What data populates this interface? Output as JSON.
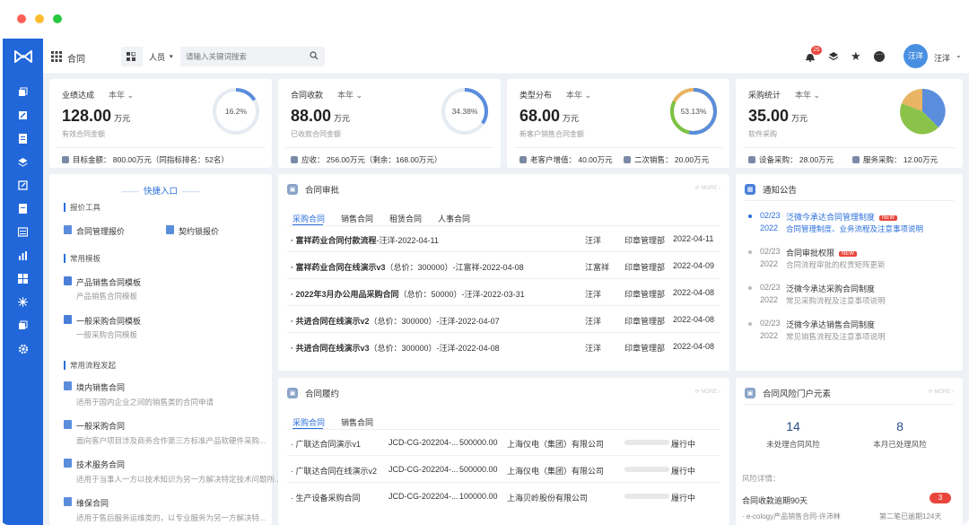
{
  "window_title": "合同",
  "topbar": {
    "app_label": "合同",
    "search_scope": "人员",
    "search_placeholder": "请输入关键词搜索",
    "notification_count": "25",
    "user_avatar_text": "汪洋",
    "user_name": "汪洋"
  },
  "kpis": [
    {
      "title": "业绩达成",
      "year": "本年",
      "value": "128.00",
      "unit": "万元",
      "sub": "有效合同金额",
      "ring_label": "16.2%",
      "ring_fraction": 0.162,
      "foot": "目标金额：  800.00万元（同指标排名：52名）"
    },
    {
      "title": "合同收款",
      "year": "本年",
      "value": "88.00",
      "unit": "万元",
      "sub": "已收款合同金额",
      "ring_label": "34.38%",
      "ring_fraction": 0.3438,
      "foot": "应收：  256.00万元（剩余：168.00万元）"
    },
    {
      "title": "类型分布",
      "year": "本年",
      "value": "68.00",
      "unit": "万元",
      "sub": "新客户销售合同金额",
      "ring_label": "53.13%",
      "ring_fraction": 0.5313,
      "foot_a": "老客户增值：  40.00万元",
      "foot_b": "二次销售：  20.00万元"
    },
    {
      "title": "采购统计",
      "year": "本年",
      "value": "35.00",
      "unit": "万元",
      "sub": "软件采购",
      "foot_a": "设备采购：  28.00万元",
      "foot_b": "服务采购：  12.00万元"
    }
  ],
  "colors": {
    "accent": "#2a6fdb",
    "sidebar": "#2167d9",
    "ring_track": "#e6ebf3",
    "ring_fill": "#4a7fd8",
    "ring_green": "#7cc243",
    "ring_yellow": "#e9b463",
    "pie_blue": "#5b8ddd",
    "pie_green": "#8bc34a",
    "pie_yellow": "#e9b463"
  },
  "quick": {
    "title": "快捷入口",
    "sec1": "报价工具",
    "item1": "合同管理报价",
    "item2": "契约锁报价",
    "sec2": "常用模板",
    "tpl1": "产品销售合同模板",
    "tpl1_sub": "产品销售合同模板",
    "tpl2": "一般采购合同模板",
    "tpl2_sub": "一般采购合同模板",
    "sec3": "常用流程发起",
    "flow1": "境内销售合同",
    "flow1_sub": "适用于国内企业之间的销售类的合同申请",
    "flow2": "一般采购合同",
    "flow2_sub": "面向客户项目涉及商务合作第三方标准产品软硬件采购...",
    "flow3": "技术服务合同",
    "flow3_sub": "适用于当事人一方以技术知识为另一方解决特定技术问题所...",
    "flow4": "维保合同",
    "flow4_sub": "适用于售后服务运维类的，以专业服务为另一方解决特..."
  },
  "approval": {
    "title": "合同审批",
    "more": "MORE",
    "tabs": [
      "采购合同",
      "销售合同",
      "租赁合同",
      "人事合同"
    ],
    "rows": [
      {
        "title": "· 富祥药业合同付款流程",
        "extra": "-汪洋-2022-04-11",
        "user": "汪洋",
        "dept": "印章管理部",
        "date": "2022-04-11"
      },
      {
        "title": "· 富祥药业合同在线演示v3",
        "extra": "（总价：300000）-江富祥-2022-04-08",
        "user": "江富祥",
        "dept": "印章管理部",
        "date": "2022-04-09"
      },
      {
        "title": "· 2022年3月办公用品采购合同",
        "extra": "（总价：50000）-汪洋-2022-03-31",
        "user": "汪洋",
        "dept": "印章管理部",
        "date": "2022-04-08"
      },
      {
        "title": "· 共进合同在线演示v2",
        "extra": "（总价：300000）-汪洋-2022-04-07",
        "user": "汪洋",
        "dept": "印章管理部",
        "date": "2022-04-08"
      },
      {
        "title": "· 共进合同在线演示v3",
        "extra": "（总价：300000）-汪洋-2022-04-08",
        "user": "汪洋",
        "dept": "印章管理部",
        "date": "2022-04-08"
      }
    ]
  },
  "perform": {
    "title": "合同履约",
    "more": "MORE",
    "tabs": [
      "采购合同",
      "销售合同"
    ],
    "rows": [
      {
        "name": "· 广联达合同演示v1",
        "code": "JCD-CG-202204-...",
        "amount": "500000.00",
        "party": "上海仪电（集团）有限公司",
        "progress": 0.0,
        "status": "履行中"
      },
      {
        "name": "· 广联达合同在线演示v2",
        "code": "JCD-CG-202204-...",
        "amount": "500000.00",
        "party": "上海仪电（集团）有限公司",
        "progress": 0.0,
        "status": "履行中"
      },
      {
        "name": "· 生产设备采购合同",
        "code": "JCD-CG-202204-...",
        "amount": "100000.00",
        "party": "上海贝岭股份有限公司",
        "progress": 0.0,
        "status": "履行中"
      }
    ]
  },
  "notice": {
    "title": "通知公告",
    "new_tag": "NEW",
    "items": [
      {
        "md": "02/23",
        "year": "2022",
        "title": "泛微今承达合同管理制度",
        "sub": "合同管理制度、业务流程及注意事项说明",
        "is_new": true,
        "active": true
      },
      {
        "md": "02/23",
        "year": "2022",
        "title": "合同审批权限",
        "sub": "合同流程审批的权责矩阵更新",
        "is_new": true,
        "active": false
      },
      {
        "md": "02/23",
        "year": "2022",
        "title": "泛微今承达采购合同制度",
        "sub": "常见采购流程及注意事项说明",
        "is_new": false,
        "active": false
      },
      {
        "md": "02/23",
        "year": "2022",
        "title": "泛微今承达销售合同制度",
        "sub": "常见销售流程及注意事项说明",
        "is_new": false,
        "active": false
      }
    ]
  },
  "risk": {
    "title": "合同风险门户元素",
    "more": "MORE",
    "stat1_value": "14",
    "stat1_label": "未处理合同风险",
    "stat2_value": "8",
    "stat2_label": "本月已处理风险",
    "detail_label": "风险详情：",
    "item1_title": "合同收款逾期90天",
    "item1_count": "3",
    "item1_sub_a": "· e-cology产品销售合同-许沛林",
    "item1_sub_b": "第二笔已逾期124天"
  }
}
